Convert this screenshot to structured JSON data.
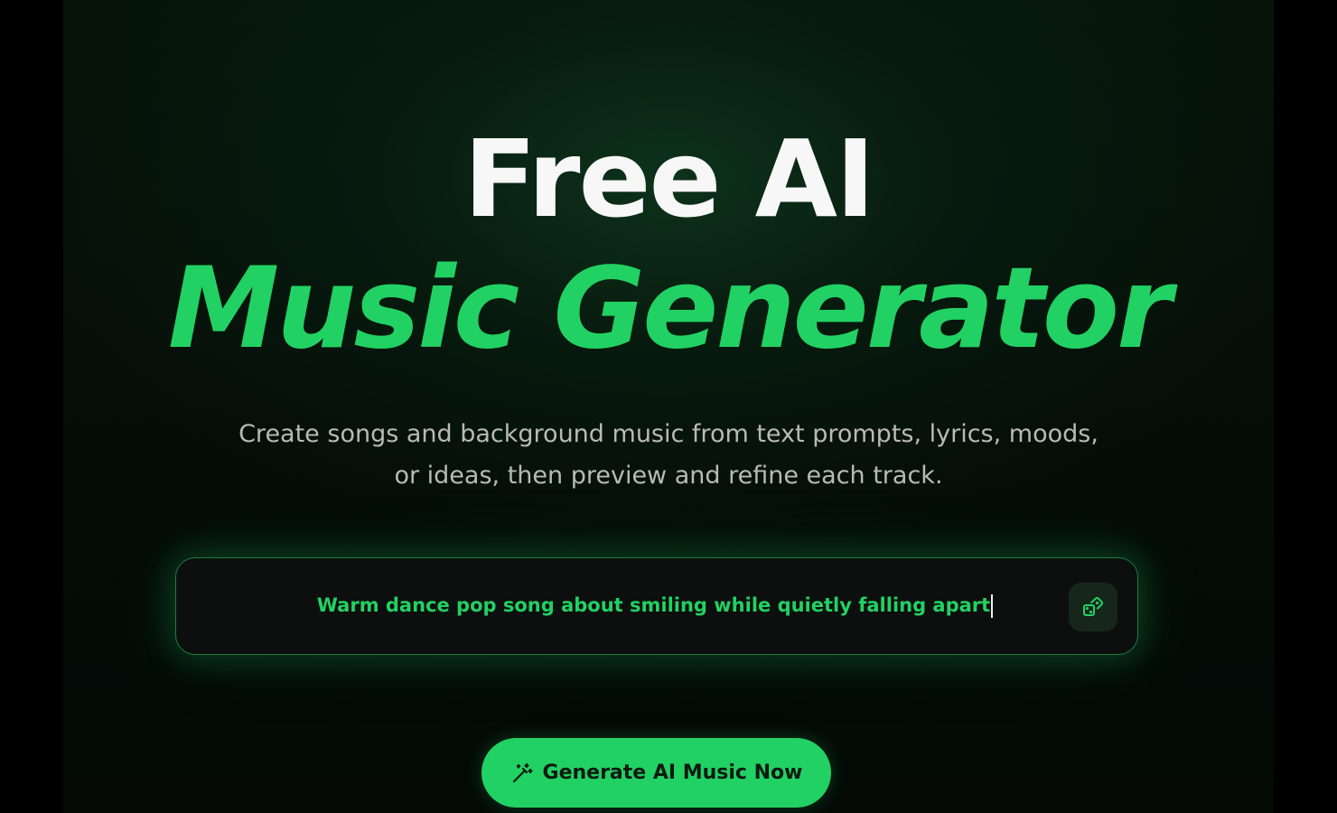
{
  "hero": {
    "title_line1": "Free AI",
    "title_line2": "Music Generator",
    "subtitle_line1": "Create songs and background music from text prompts, lyrics, moods,",
    "subtitle_line2": "or ideas, then preview and refine each track."
  },
  "prompt": {
    "value": "Warm dance pop song about smiling while quietly falling apart",
    "random_icon": "dice-icon"
  },
  "cta": {
    "label": "Generate AI Music Now",
    "icon": "magic-wand-icon"
  },
  "colors": {
    "accent": "#22d163",
    "background": "#050d08",
    "title": "#f7f7f7",
    "subtitle": "#b9b9b9"
  }
}
